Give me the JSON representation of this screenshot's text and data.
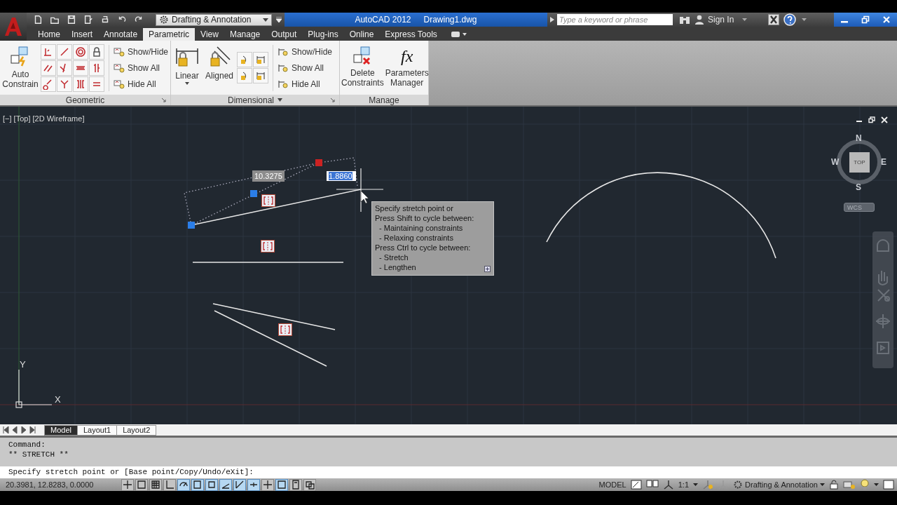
{
  "title_bar": {
    "workspace": "Drafting & Annotation",
    "app": "AutoCAD 2012",
    "document": "Drawing1.dwg",
    "search_placeholder": "Type a keyword or phrase",
    "sign_in": "Sign In"
  },
  "ribbon_tabs": [
    {
      "label": "Home",
      "selected": false
    },
    {
      "label": "Insert",
      "selected": false
    },
    {
      "label": "Annotate",
      "selected": false
    },
    {
      "label": "Parametric",
      "selected": true
    },
    {
      "label": "View",
      "selected": false
    },
    {
      "label": "Manage",
      "selected": false
    },
    {
      "label": "Output",
      "selected": false
    },
    {
      "label": "Plug-ins",
      "selected": false
    },
    {
      "label": "Online",
      "selected": false
    },
    {
      "label": "Express Tools",
      "selected": false
    }
  ],
  "geometric_panel": {
    "title": "Geometric",
    "auto_constrain": "Auto Constrain",
    "commands": [
      "Show/Hide",
      "Show All",
      "Hide All"
    ]
  },
  "dimensional_panel": {
    "title": "Dimensional",
    "linear": "Linear",
    "aligned": "Aligned",
    "commands": [
      "Show/Hide",
      "Show All",
      "Hide All"
    ]
  },
  "manage_panel": {
    "title": "Manage",
    "delete_constraints": "Delete Constraints",
    "parameters_icon": "fx",
    "parameters_manager": "Parameters Manager"
  },
  "viewport": {
    "label": "[−] [Top] [2D Wireframe]",
    "dimension": "10.3275",
    "input_value": "1.8860",
    "tooltip": [
      "Specify stretch point or",
      "Press Shift to cycle between:",
      "  - Maintaining constraints",
      "  - Relaxing constraints",
      "Press Ctrl to cycle between:",
      "  - Stretch",
      "  - Lengthen"
    ],
    "viewcube": {
      "north": "N",
      "south": "S",
      "east": "E",
      "west": "W",
      "face": "TOP",
      "ucs": "WCS"
    },
    "ucs_y": "Y",
    "ucs_x": "X"
  },
  "layout_tabs": [
    {
      "label": "Model",
      "selected": true
    },
    {
      "label": "Layout1",
      "selected": false
    },
    {
      "label": "Layout2",
      "selected": false
    }
  ],
  "command_history": [
    "Command:",
    "** STRETCH **"
  ],
  "command_prompt": "Specify stretch point or [Base point/Copy/Undo/eXit]:",
  "status_bar": {
    "coordinates": "20.3981, 12.8283, 0.0000",
    "toggles": [
      {
        "on": false
      },
      {
        "on": false
      },
      {
        "on": false
      },
      {
        "on": false
      },
      {
        "on": true
      },
      {
        "on": true
      },
      {
        "on": true
      },
      {
        "on": true
      },
      {
        "on": true
      },
      {
        "on": true
      },
      {
        "on": false
      },
      {
        "on": true
      },
      {
        "on": false
      },
      {
        "on": false
      }
    ],
    "space": "MODEL",
    "scale": "1:1",
    "workspace": "Drafting & Annotation"
  }
}
